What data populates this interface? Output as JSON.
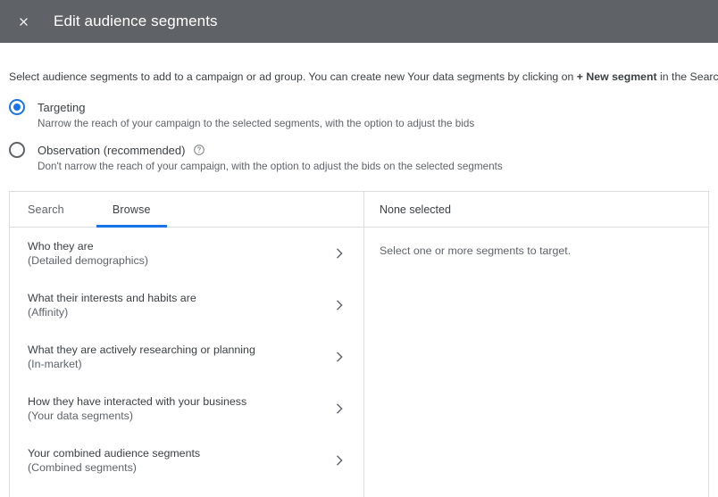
{
  "header": {
    "close_label": "Close",
    "close_icon": "close-icon",
    "title": "Edit audience segments",
    "bg_color": "#5f6368",
    "text_color": "#ffffff"
  },
  "intro": {
    "text_before": "Select audience segments to add to a campaign or ad group. You can create new Your data segments by clicking on ",
    "emphasis": "+ New segment",
    "text_after": " in the Search tab.",
    "help_icon": "help-circle-icon"
  },
  "targeting_options": [
    {
      "id": "targeting",
      "label": "Targeting",
      "description": "Narrow the reach of your campaign to the selected segments, with the option to adjust the bids",
      "selected": true,
      "has_help": false
    },
    {
      "id": "observation",
      "label": "Observation (recommended)",
      "description": "Don't narrow the reach of your campaign, with the option to adjust the bids on the selected segments",
      "selected": false,
      "has_help": true
    }
  ],
  "panel_left": {
    "tabs": [
      {
        "label": "Search",
        "active": false
      },
      {
        "label": "Browse",
        "active": true
      }
    ],
    "categories": [
      {
        "title": "Who they are",
        "subtitle": "(Detailed demographics)",
        "chevron_icon": "chevron-right-icon"
      },
      {
        "title": "What their interests and habits are",
        "subtitle": "(Affinity)",
        "chevron_icon": "chevron-right-icon"
      },
      {
        "title": "What they are actively researching or planning",
        "subtitle": "(In-market)",
        "chevron_icon": "chevron-right-icon"
      },
      {
        "title": "How they have interacted with your business",
        "subtitle": "(Your data segments)",
        "chevron_icon": "chevron-right-icon"
      },
      {
        "title": "Your combined audience segments",
        "subtitle": "(Combined segments)",
        "chevron_icon": "chevron-right-icon"
      }
    ]
  },
  "panel_right": {
    "header": "None selected",
    "empty_message": "Select one or more segments to target."
  },
  "colors": {
    "accent": "#1a73e8",
    "header_bar": "#5f6368",
    "border": "#dadce0",
    "text_primary": "#3c4043",
    "text_secondary": "#5f6368"
  }
}
